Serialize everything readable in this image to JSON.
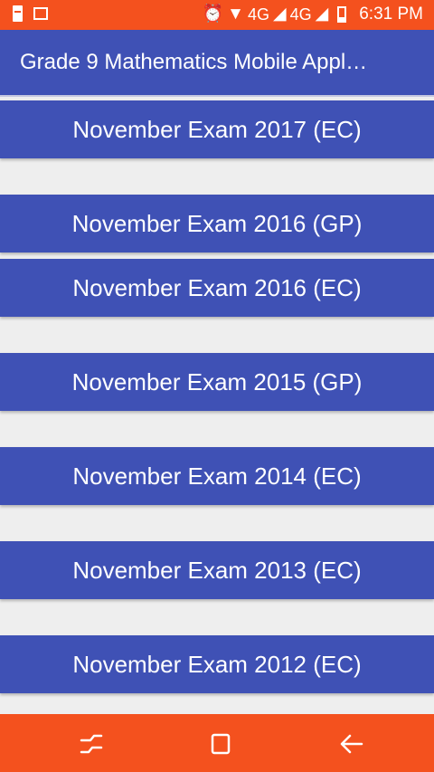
{
  "status_bar": {
    "network_1": "4G",
    "network_2": "4G",
    "time": "6:31 PM"
  },
  "app_bar": {
    "title": "Grade 9 Mathematics Mobile Appl…"
  },
  "exams": [
    {
      "label": "November Exam 2017 (EC)"
    },
    {
      "label": "November Exam 2016 (GP)"
    },
    {
      "label": "November Exam 2016 (EC)"
    },
    {
      "label": "November Exam 2015 (GP)"
    },
    {
      "label": "November Exam 2014 (EC)"
    },
    {
      "label": "November Exam 2013 (EC)"
    },
    {
      "label": "November Exam 2012 (EC)"
    }
  ],
  "icons": {
    "status_left": [
      "battery-saver-icon",
      "image-icon"
    ],
    "status_right": [
      "alarm-icon",
      "wifi-icon",
      "signal-icon",
      "battery-icon"
    ],
    "nav": [
      "recent-apps-icon",
      "home-icon",
      "back-icon"
    ]
  },
  "colors": {
    "status_bar": "#f4511e",
    "app_bar": "#3f51b5",
    "list_item": "#3f51b5",
    "background": "#eeeeee",
    "nav_bar": "#f4511e"
  }
}
